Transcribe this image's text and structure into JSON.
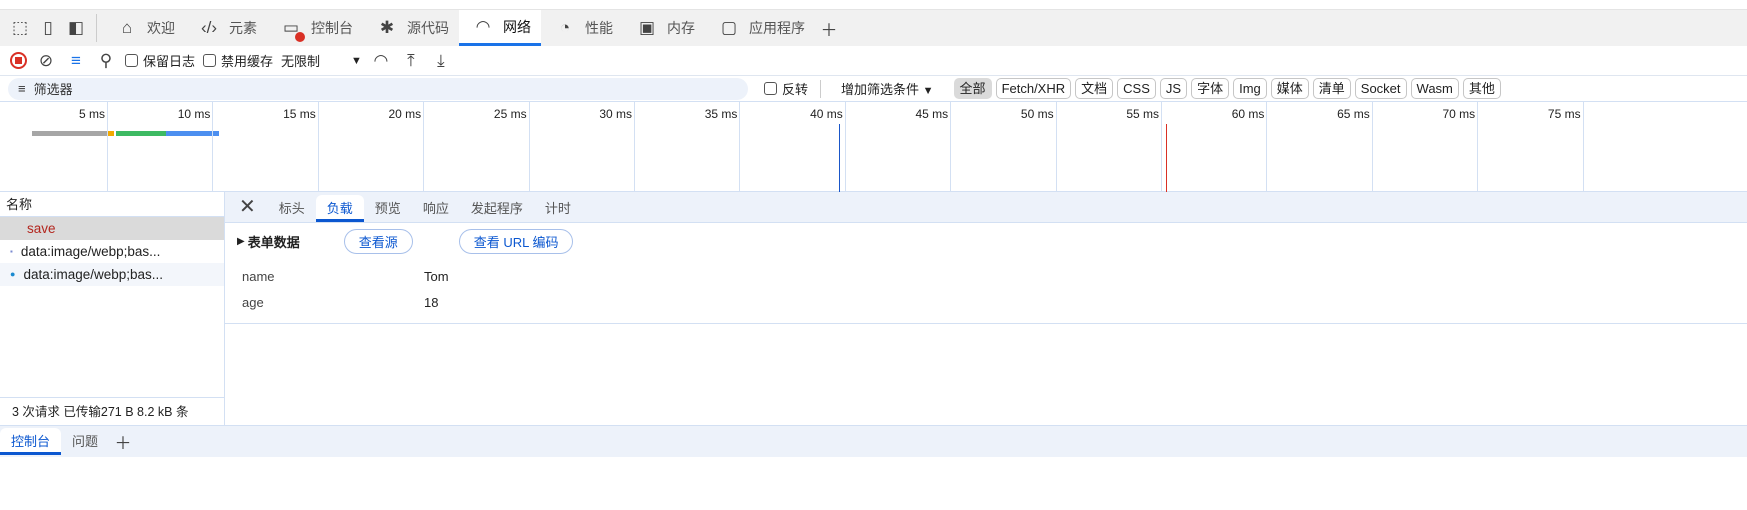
{
  "main_tabs": [
    {
      "label": "欢迎",
      "icon": "home-icon"
    },
    {
      "label": "元素",
      "icon": "code-icon"
    },
    {
      "label": "控制台",
      "icon": "console-icon"
    },
    {
      "label": "源代码",
      "icon": "bug-icon"
    },
    {
      "label": "网络",
      "icon": "wifi-icon",
      "active": true
    },
    {
      "label": "性能",
      "icon": "gauge-icon"
    },
    {
      "label": "内存",
      "icon": "chip-icon"
    },
    {
      "label": "应用程序",
      "icon": "app-icon"
    }
  ],
  "toolbar": {
    "preserve_log": "保留日志",
    "disable_cache": "禁用缓存",
    "throttle": "无限制"
  },
  "filter": {
    "placeholder": "筛选器",
    "invert": "反转",
    "more_filters": "增加筛选条件",
    "types": [
      "全部",
      "Fetch/XHR",
      "文档",
      "CSS",
      "JS",
      "字体",
      "Img",
      "媒体",
      "清单",
      "Socket",
      "Wasm",
      "其他"
    ]
  },
  "timeline": {
    "ticks": [
      "5 ms",
      "10 ms",
      "15 ms",
      "20 ms",
      "25 ms",
      "30 ms",
      "35 ms",
      "40 ms",
      "45 ms",
      "50 ms",
      "55 ms",
      "60 ms",
      "65 ms",
      "70 ms",
      "75 ms"
    ],
    "dom_content_loaded_ms": 39.7,
    "load_ms": 55.2
  },
  "requests": {
    "header": "名称",
    "items": [
      "save",
      "data:image/webp;bas...",
      "data:image/webp;bas..."
    ],
    "summary": "3 次请求   已传输271 B   8.2 kB 条"
  },
  "details": {
    "tabs": [
      "标头",
      "负载",
      "预览",
      "响应",
      "发起程序",
      "计时"
    ],
    "active": "负载",
    "section": "表单数据",
    "view_source": "查看源",
    "view_url": "查看 URL 编码",
    "fields": [
      {
        "key": "name",
        "value": "Tom"
      },
      {
        "key": "age",
        "value": "18"
      }
    ]
  },
  "drawer": {
    "tabs": [
      "控制台",
      "问题"
    ]
  }
}
